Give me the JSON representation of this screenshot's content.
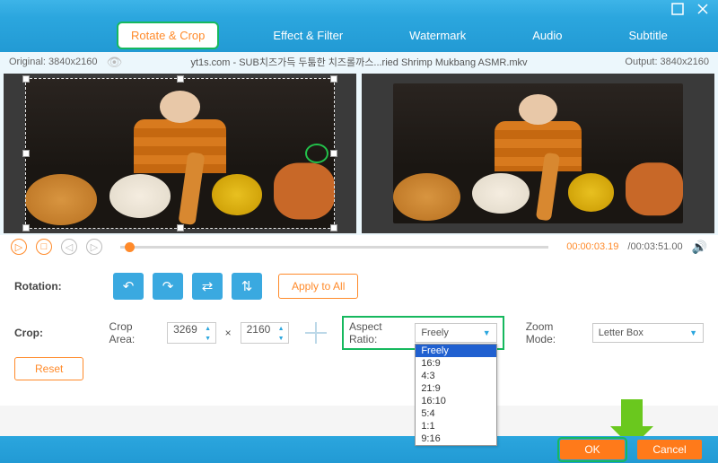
{
  "titlebar": {
    "minimize": "minimize",
    "close": "close"
  },
  "tabs": {
    "rotate_crop": "Rotate & Crop",
    "effect_filter": "Effect & Filter",
    "watermark": "Watermark",
    "audio": "Audio",
    "subtitle": "Subtitle"
  },
  "info": {
    "original_label": "Original: 3840x2160",
    "filename": "yt1s.com - SUB치즈가득 두툼한 치즈롤까스...ried Shrimp Mukbang ASMR.mkv",
    "output_label": "Output: 3840x2160"
  },
  "transport": {
    "current": "00:00:03.19",
    "total": "/00:03:51.00"
  },
  "rotation": {
    "label": "Rotation:",
    "apply_all": "Apply to All"
  },
  "crop": {
    "label": "Crop:",
    "area_label": "Crop Area:",
    "width": "3269",
    "times": "×",
    "height": "2160",
    "aspect_label": "Aspect Ratio:",
    "aspect_value": "Freely",
    "zoom_label": "Zoom Mode:",
    "zoom_value": "Letter Box",
    "reset": "Reset",
    "options": [
      "Freely",
      "16:9",
      "4:3",
      "21:9",
      "16:10",
      "5:4",
      "1:1",
      "9:16"
    ]
  },
  "footer": {
    "ok": "OK",
    "cancel": "Cancel"
  }
}
